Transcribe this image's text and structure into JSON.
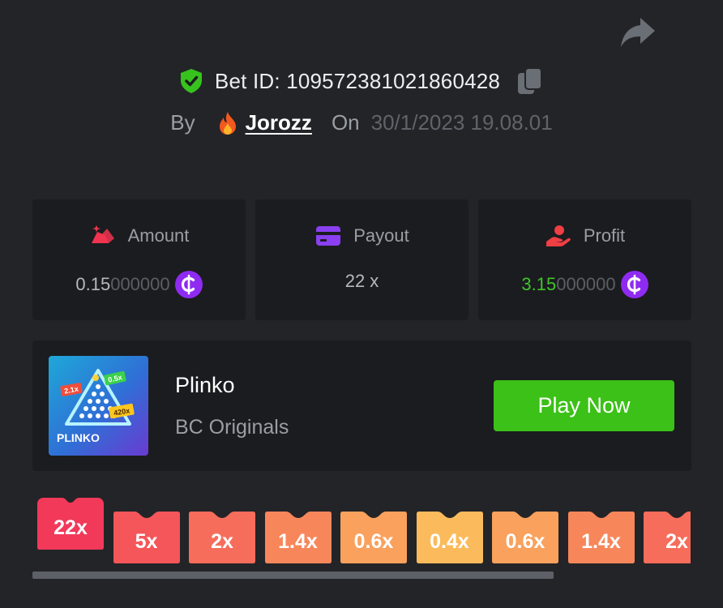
{
  "bet": {
    "label": "Bet ID: 109572381021860428"
  },
  "by_line": {
    "by_label": "By",
    "username": "Jorozz",
    "on_label": "On",
    "date": "30/1/2023 19.08.01"
  },
  "stats": [
    {
      "label": "Amount",
      "value_main": "0.15",
      "value_dim": "000000",
      "icon": "coins-icon"
    },
    {
      "label": "Payout",
      "value_main": "22 x",
      "icon": "card-icon"
    },
    {
      "label": "Profit",
      "value_main": "3.15",
      "value_dim": "000000",
      "icon": "hand-money-icon"
    }
  ],
  "game": {
    "name": "Plinko",
    "provider": "BC Originals",
    "play_label": "Play Now",
    "thumb_title": "PLINKO",
    "thumb_tags": [
      "2.1x",
      "0.5x",
      "420x"
    ]
  },
  "multipliers": [
    {
      "label": "22x",
      "color": "#f2395a",
      "active": true
    },
    {
      "label": "5x",
      "color": "#f4565a"
    },
    {
      "label": "2x",
      "color": "#f66d5b"
    },
    {
      "label": "1.4x",
      "color": "#f7875b"
    },
    {
      "label": "0.6x",
      "color": "#f9a15d"
    },
    {
      "label": "0.4x",
      "color": "#fbbb5c"
    },
    {
      "label": "0.6x",
      "color": "#f9a15d"
    },
    {
      "label": "1.4x",
      "color": "#f7875b"
    },
    {
      "label": "2x",
      "color": "#f66d5b"
    }
  ],
  "colors": {
    "background": "#232427",
    "card": "#1b1c1f",
    "accent_green": "#3bc117",
    "coin_purple": "#8f2bf1"
  }
}
